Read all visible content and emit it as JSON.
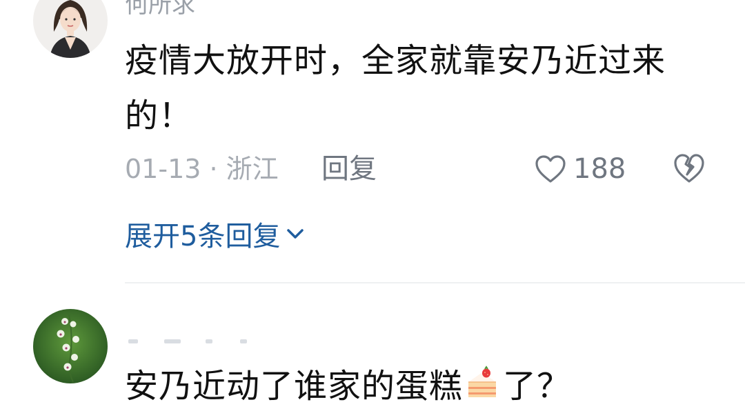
{
  "comments": [
    {
      "username": "何所求",
      "text": "疫情大放开时，全家就靠安乃近过来的！",
      "date_location": "01-13 · 浙江",
      "reply_label": "回复",
      "like_count": "188",
      "expand_label": "展开5条回复"
    },
    {
      "text_before_emoji": "安乃近动了谁家的蛋糕",
      "emoji": "cake-icon",
      "text_after_emoji": "了？"
    }
  ],
  "colors": {
    "link_blue": "#1f5d9e",
    "meta_gray": "#a6abb2",
    "action_gray": "#6f7680",
    "text_dark": "#111111"
  }
}
